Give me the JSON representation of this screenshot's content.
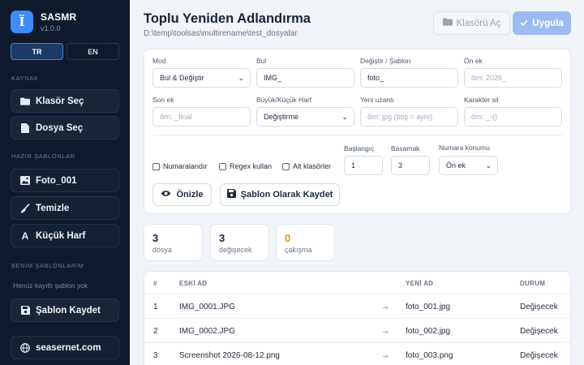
{
  "app": {
    "name": "SASMR",
    "version": "v1.0.0",
    "logo_glyph": "Ï"
  },
  "lang": {
    "tr": "TR",
    "en": "EN",
    "active": "TR"
  },
  "sidebar": {
    "section_source": "KAYNAK",
    "folder_select": "Klasör Seç",
    "file_select": "Dosya Seç",
    "section_templates": "HAZIR ŞABLONLAR",
    "tpl_photo": "Foto_001",
    "tpl_clean": "Temizle",
    "tpl_lower": "Küçük Harf",
    "section_mine": "BENİM ŞABLONLARIM",
    "empty_note": "Henüz kayıtlı şablon yok",
    "save_template": "Şablon Kaydet",
    "website": "seasernet.com"
  },
  "header": {
    "title": "Toplu Yeniden Adlandırma",
    "path": "D:\\temp\\toolsas\\multirename\\test_dosyalar",
    "open_folder": "Klasörü Aç",
    "apply": "Uygula"
  },
  "form": {
    "mode_label": "Mod",
    "mode_value": "Bul & Değiştir",
    "find_label": "Bul",
    "find_value": "IMG_",
    "replace_label": "Değiştir / Şablon",
    "replace_value": "foto_",
    "prefix_label": "Ön ek",
    "prefix_placeholder": "örn: 2026_",
    "suffix_label": "Son ek",
    "suffix_placeholder": "örn: _final",
    "case_label": "Büyük/Küçük Harf",
    "case_value": "Değiştirme",
    "ext_label": "Yeni uzantı",
    "ext_placeholder": "örn: jpg (boş = aynı)",
    "delchars_label": "Karakter sil",
    "delchars_placeholder": "örn: _-()",
    "numbering_label": "Numaralandır",
    "regex_label": "Regex kullan",
    "subfolders_label": "Alt klasörler",
    "start_label": "Başlangıç",
    "start_value": "1",
    "step_label": "Basamak",
    "step_value": "3",
    "numpos_label": "Numara konumu",
    "numpos_value": "Ön ek",
    "preview_button": "Önizle",
    "save_template_button": "Şablon Olarak Kaydet"
  },
  "stats": [
    {
      "value": "3",
      "label": "dosya"
    },
    {
      "value": "3",
      "label": "değişecek"
    },
    {
      "value": "0",
      "label": "çakışma"
    }
  ],
  "table": {
    "headers": {
      "num": "#",
      "old": "ESKİ AD",
      "new": "YENİ AD",
      "status": "DURUM"
    },
    "arrow": "→",
    "rows": [
      {
        "num": "1",
        "old": "IMG_0001.JPG",
        "new": "foto_001.jpg",
        "status": "Değişecek"
      },
      {
        "num": "2",
        "old": "IMG_0002.JPG",
        "new": "foto_002.jpg",
        "status": "Değişecek"
      },
      {
        "num": "3",
        "old": "Screenshot 2026-08-12.png",
        "new": "foto_003.png",
        "status": "Değişecek"
      }
    ]
  },
  "colors": {
    "accent": "#3f8cf7",
    "sidebar_bg": "#0f1a2c",
    "conflict": "#e0902a",
    "apply_btn": "#9bbcf2"
  }
}
